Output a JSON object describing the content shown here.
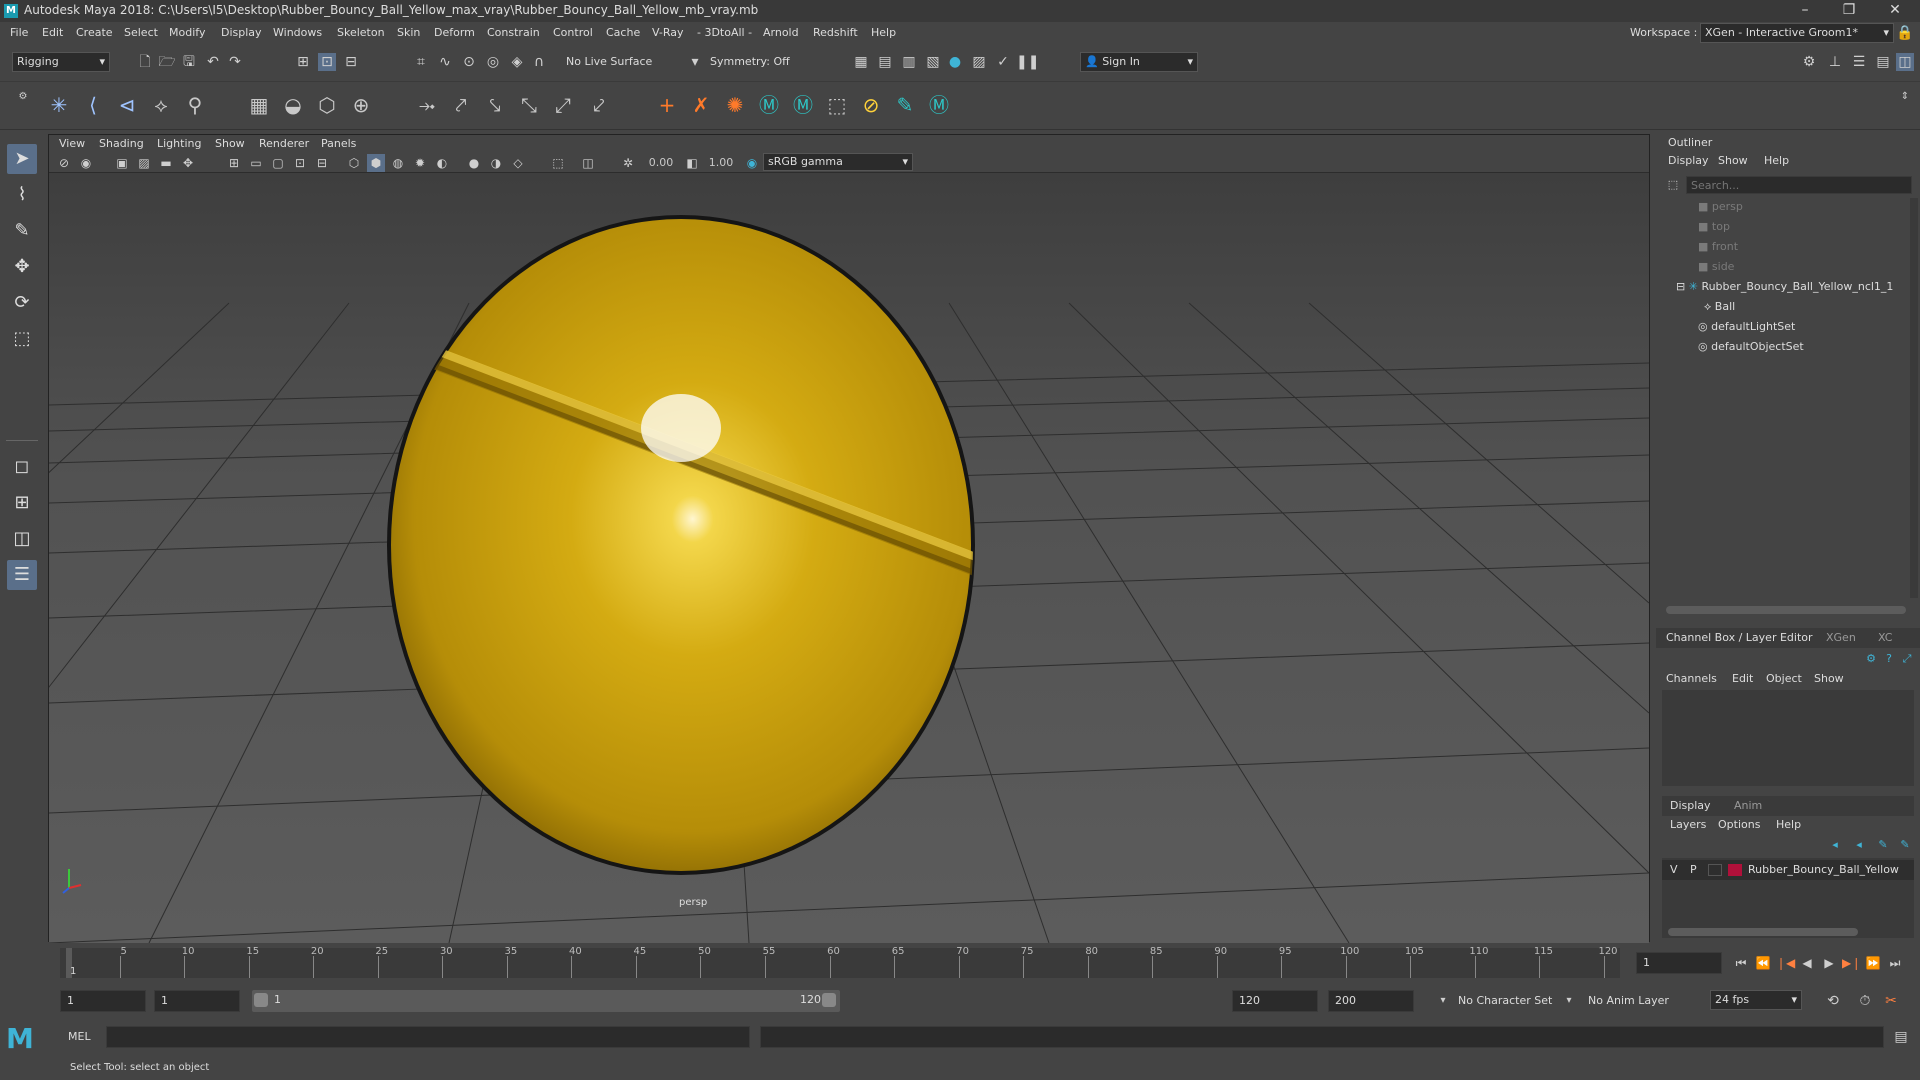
{
  "window": {
    "title": "Autodesk Maya 2018: C:\\Users\\I5\\Desktop\\Rubber_Bouncy_Ball_Yellow_max_vray\\Rubber_Bouncy_Ball_Yellow_mb_vray.mb",
    "logo": "M",
    "minimize_icon": "–",
    "maximize_icon": "❐",
    "close_icon": "✕"
  },
  "menubar": {
    "items": [
      "File",
      "Edit",
      "Create",
      "Select",
      "Modify",
      "Display",
      "Windows",
      "Skeleton",
      "Skin",
      "Deform",
      "Constrain",
      "Control",
      "Cache",
      "V-Ray",
      "- 3DtoAll -",
      "Arnold",
      "Redshift",
      "Help"
    ],
    "workspace_label": "Workspace :",
    "workspace_value": "XGen - Interactive Groom1*"
  },
  "statusline": {
    "mode": "Rigging",
    "live_surface": "No Live Surface",
    "symmetry": "Symmetry: Off",
    "sign_in": "Sign In"
  },
  "viewport": {
    "menus": [
      "View",
      "Shading",
      "Lighting",
      "Show",
      "Renderer",
      "Panels"
    ],
    "exposure": "0.00",
    "gamma": "1.00",
    "color_space": "sRGB gamma",
    "camera_label": "persp",
    "ball_color": "#c9a210"
  },
  "outliner": {
    "title": "Outliner",
    "menus": [
      "Display",
      "Show",
      "Help"
    ],
    "search_placeholder": "Search...",
    "items": [
      {
        "label": "persp",
        "icon": "camera-icon",
        "dim": true
      },
      {
        "label": "top",
        "icon": "camera-icon",
        "dim": true
      },
      {
        "label": "front",
        "icon": "camera-icon",
        "dim": true
      },
      {
        "label": "side",
        "icon": "camera-icon",
        "dim": true
      },
      {
        "label": "Rubber_Bouncy_Ball_Yellow_ncl1_1",
        "icon": "joint-icon",
        "dim": false
      },
      {
        "label": "Ball",
        "icon": "mesh-icon",
        "dim": false
      },
      {
        "label": "defaultLightSet",
        "icon": "set-icon",
        "dim": false
      },
      {
        "label": "defaultObjectSet",
        "icon": "set-icon",
        "dim": false
      }
    ]
  },
  "channel_box": {
    "title": "Channel Box / Layer Editor",
    "tab_xgen": "XGen",
    "tab_more": "XC",
    "menus": [
      "Channels",
      "Edit",
      "Object",
      "Show"
    ],
    "layer_tabs": [
      "Display",
      "Anim"
    ],
    "layer_menus": [
      "Layers",
      "Options",
      "Help"
    ],
    "layer": {
      "v": "V",
      "p": "P",
      "name": "Rubber_Bouncy_Ball_Yellow",
      "color": "#b0103a"
    }
  },
  "timeline": {
    "ticks": [
      "5",
      "10",
      "15",
      "20",
      "25",
      "30",
      "35",
      "40",
      "45",
      "50",
      "55",
      "60",
      "65",
      "70",
      "75",
      "80",
      "85",
      "90",
      "95",
      "100",
      "105",
      "110",
      "115",
      "120"
    ],
    "current_marker": "1",
    "current_frame": "1"
  },
  "range": {
    "start": "1",
    "playback_start": "1",
    "slider_start": "1",
    "slider_end": "120",
    "playback_end": "120",
    "end": "200",
    "character_set": "No Character Set",
    "anim_layer": "No Anim Layer",
    "fps": "24 fps"
  },
  "command": {
    "label": "MEL",
    "help": "Select Tool: select an object"
  }
}
